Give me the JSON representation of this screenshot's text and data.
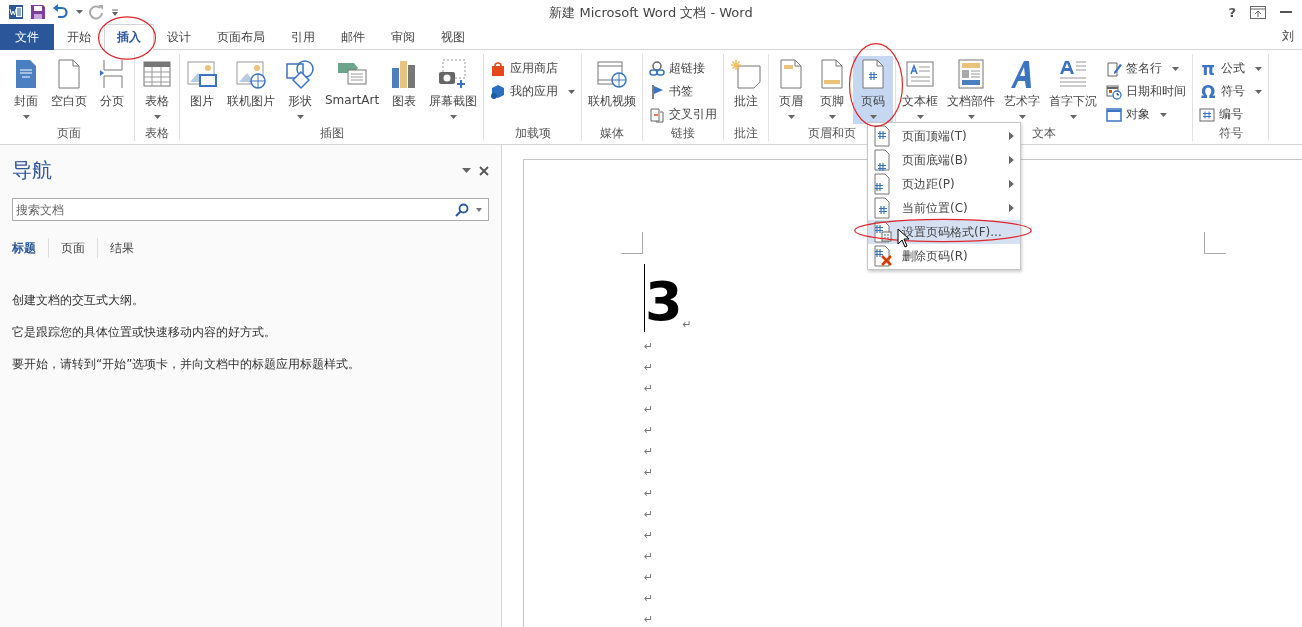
{
  "window": {
    "title": "新建 Microsoft Word 文档 - Word",
    "help": "?",
    "user": "刘"
  },
  "tabs": [
    {
      "label": "文件",
      "kind": "file",
      "selected": false,
      "circled": false
    },
    {
      "label": "开始",
      "kind": "tab",
      "selected": false,
      "circled": false
    },
    {
      "label": "插入",
      "kind": "tab",
      "selected": true,
      "circled": true
    },
    {
      "label": "设计",
      "kind": "tab",
      "selected": false,
      "circled": false
    },
    {
      "label": "页面布局",
      "kind": "tab",
      "selected": false,
      "circled": false
    },
    {
      "label": "引用",
      "kind": "tab",
      "selected": false,
      "circled": false
    },
    {
      "label": "邮件",
      "kind": "tab",
      "selected": false,
      "circled": false
    },
    {
      "label": "审阅",
      "kind": "tab",
      "selected": false,
      "circled": false
    },
    {
      "label": "视图",
      "kind": "tab",
      "selected": false,
      "circled": false
    }
  ],
  "ribbon": {
    "groups": [
      {
        "label": "页面",
        "items": [
          {
            "kind": "large",
            "label": "封面",
            "dropdown": true,
            "pressed": false,
            "circled": false
          },
          {
            "kind": "large",
            "label": "空白页",
            "dropdown": false,
            "pressed": false,
            "circled": false
          },
          {
            "kind": "large",
            "label": "分页",
            "dropdown": false,
            "pressed": false,
            "circled": false
          }
        ]
      },
      {
        "label": "表格",
        "items": [
          {
            "kind": "large",
            "label": "表格",
            "dropdown": true,
            "pressed": false,
            "circled": false
          }
        ]
      },
      {
        "label": "插图",
        "items": [
          {
            "kind": "large",
            "label": "图片",
            "dropdown": false,
            "pressed": false,
            "circled": false
          },
          {
            "kind": "large",
            "label": "联机图片",
            "dropdown": false,
            "pressed": false,
            "circled": false
          },
          {
            "kind": "large",
            "label": "形状",
            "dropdown": true,
            "pressed": false,
            "circled": false
          },
          {
            "kind": "large",
            "label": "SmartArt",
            "dropdown": false,
            "pressed": false,
            "circled": false
          },
          {
            "kind": "large",
            "label": "图表",
            "dropdown": false,
            "pressed": false,
            "circled": false
          },
          {
            "kind": "large",
            "label": "屏幕截图",
            "dropdown": true,
            "pressed": false,
            "circled": false
          }
        ]
      },
      {
        "label": "加载项",
        "items": [
          {
            "kind": "stack",
            "items": [
              {
                "label": "应用商店",
                "dropdown": false
              },
              {
                "label": "我的应用",
                "dropdown": true
              }
            ]
          }
        ]
      },
      {
        "label": "媒体",
        "items": [
          {
            "kind": "large",
            "label": "联机视频",
            "dropdown": false,
            "pressed": false,
            "circled": false
          }
        ]
      },
      {
        "label": "链接",
        "items": [
          {
            "kind": "stack",
            "items": [
              {
                "label": "超链接",
                "dropdown": false
              },
              {
                "label": "书签",
                "dropdown": false
              },
              {
                "label": "交叉引用",
                "dropdown": false
              }
            ]
          }
        ]
      },
      {
        "label": "批注",
        "items": [
          {
            "kind": "large",
            "label": "批注",
            "dropdown": false,
            "pressed": false,
            "circled": false
          }
        ]
      },
      {
        "label": "页眉和页",
        "items": [
          {
            "kind": "large",
            "label": "页眉",
            "dropdown": true,
            "pressed": false,
            "circled": false
          },
          {
            "kind": "large",
            "label": "页脚",
            "dropdown": true,
            "pressed": false,
            "circled": false
          },
          {
            "kind": "large",
            "label": "页码",
            "dropdown": true,
            "pressed": true,
            "circled": true
          }
        ]
      },
      {
        "label": "文本",
        "items": [
          {
            "kind": "large",
            "label": "文本框",
            "dropdown": true,
            "pressed": false,
            "circled": false
          },
          {
            "kind": "large",
            "label": "文档部件",
            "dropdown": true,
            "pressed": false,
            "circled": false
          },
          {
            "kind": "large",
            "label": "艺术字",
            "dropdown": true,
            "pressed": false,
            "circled": false
          },
          {
            "kind": "large",
            "label": "首字下沉",
            "dropdown": true,
            "pressed": false,
            "circled": false
          },
          {
            "kind": "stack",
            "items": [
              {
                "label": "签名行",
                "dropdown": true
              },
              {
                "label": "日期和时间",
                "dropdown": false
              },
              {
                "label": "对象",
                "dropdown": true
              }
            ]
          }
        ]
      },
      {
        "label": "符号",
        "items": [
          {
            "kind": "stack",
            "items": [
              {
                "label": "公式",
                "dropdown": true,
                "glyph": "π"
              },
              {
                "label": "符号",
                "dropdown": true,
                "glyph": "Ω"
              },
              {
                "label": "编号",
                "dropdown": false
              }
            ]
          }
        ]
      }
    ]
  },
  "navigation": {
    "title": "导航",
    "search_placeholder": "搜索文档",
    "tabs": [
      {
        "label": "标题",
        "selected": true
      },
      {
        "label": "页面",
        "selected": false
      },
      {
        "label": "结果",
        "selected": false
      }
    ],
    "paragraphs": [
      "创建文档的交互式大纲。",
      "它是跟踪您的具体位置或快速移动内容的好方式。",
      "要开始，请转到“开始”选项卡，并向文档中的标题应用标题样式。"
    ]
  },
  "document": {
    "heading": "3",
    "heading_mark": "↵",
    "paragraph_marks": [
      "↵",
      "↵",
      "↵",
      "↵",
      "↵",
      "↵",
      "↵",
      "↵",
      "↵",
      "↵",
      "↵",
      "↵",
      "↵",
      "↵"
    ]
  },
  "page_number_menu": {
    "items": [
      {
        "label": "页面顶端(T)",
        "submenu": true,
        "selected": false,
        "circled": false
      },
      {
        "label": "页面底端(B)",
        "submenu": true,
        "selected": false,
        "circled": false
      },
      {
        "label": "页边距(P)",
        "submenu": true,
        "selected": false,
        "circled": false
      },
      {
        "label": "当前位置(C)",
        "submenu": true,
        "selected": false,
        "circled": false
      },
      {
        "label": "设置页码格式(F)...",
        "submenu": false,
        "selected": true,
        "circled": true
      },
      {
        "label": "删除页码(R)",
        "submenu": false,
        "selected": false,
        "circled": false
      }
    ]
  }
}
